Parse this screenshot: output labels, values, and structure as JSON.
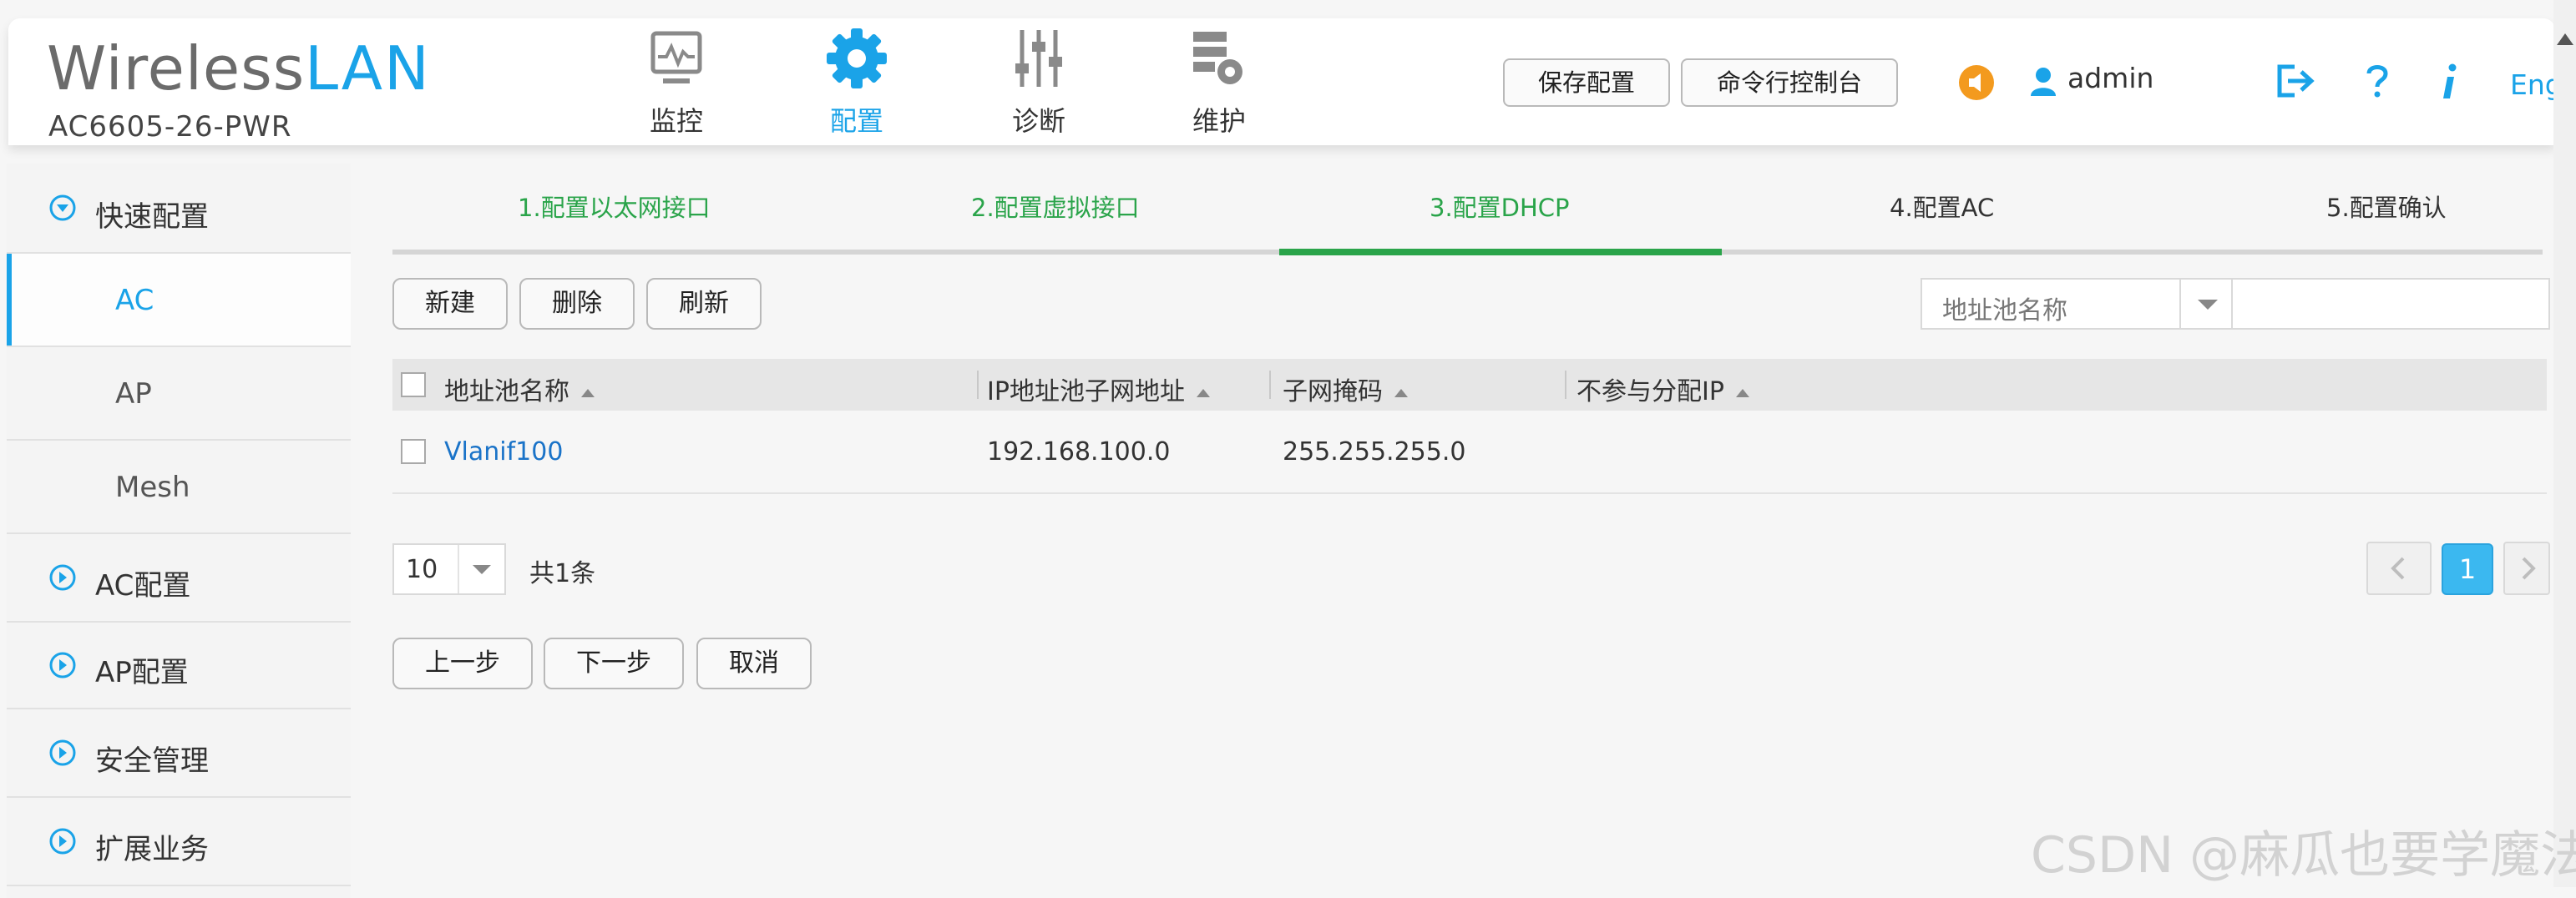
{
  "header": {
    "brand_prefix": "Wireless",
    "brand_suffix": "LAN",
    "model": "AC6605-26-PWR",
    "nav": [
      {
        "label": "监控",
        "icon": "monitor-icon"
      },
      {
        "label": "配置",
        "icon": "gear-icon",
        "active": true
      },
      {
        "label": "诊断",
        "icon": "sliders-icon"
      },
      {
        "label": "维护",
        "icon": "server-gear-icon"
      }
    ],
    "save_config_label": "保存配置",
    "cli_console_label": "命令行控制台",
    "user_name": "admin",
    "lang_label": "Eng"
  },
  "sidebar": {
    "quick_config": "快速配置",
    "quick_sub": [
      "AC",
      "AP",
      "Mesh"
    ],
    "ac_config": "AC配置",
    "ap_config": "AP配置",
    "security": "安全管理",
    "extension": "扩展业务"
  },
  "steps": [
    {
      "label": "1.配置以太网接口",
      "state": "done"
    },
    {
      "label": "2.配置虚拟接口",
      "state": "done"
    },
    {
      "label": "3.配置DHCP",
      "state": "active"
    },
    {
      "label": "4.配置AC",
      "state": "todo"
    },
    {
      "label": "5.配置确认",
      "state": "todo"
    }
  ],
  "toolbar": {
    "new_label": "新建",
    "delete_label": "删除",
    "refresh_label": "刷新",
    "search_field_placeholder": "地址池名称"
  },
  "table": {
    "columns": [
      "地址池名称",
      "IP地址池子网地址",
      "子网掩码",
      "不参与分配IP"
    ],
    "rows": [
      {
        "name": "Vlanif100",
        "subnet": "192.168.100.0",
        "mask": "255.255.255.0",
        "excluded": ""
      }
    ]
  },
  "pagination": {
    "page_size": "10",
    "total_text": "共1条",
    "current_page": "1"
  },
  "wizard_buttons": {
    "prev_label": "上一步",
    "next_label": "下一步",
    "cancel_label": "取消"
  },
  "watermark": "CSDN @麻瓜也要学魔法",
  "colors": {
    "accent_blue": "#1aa3e8",
    "step_done_green": "#2aa44a",
    "link_blue": "#1a73c8",
    "speaker_orange": "#f39a1e",
    "page_active_blue": "#3bb8f0"
  }
}
